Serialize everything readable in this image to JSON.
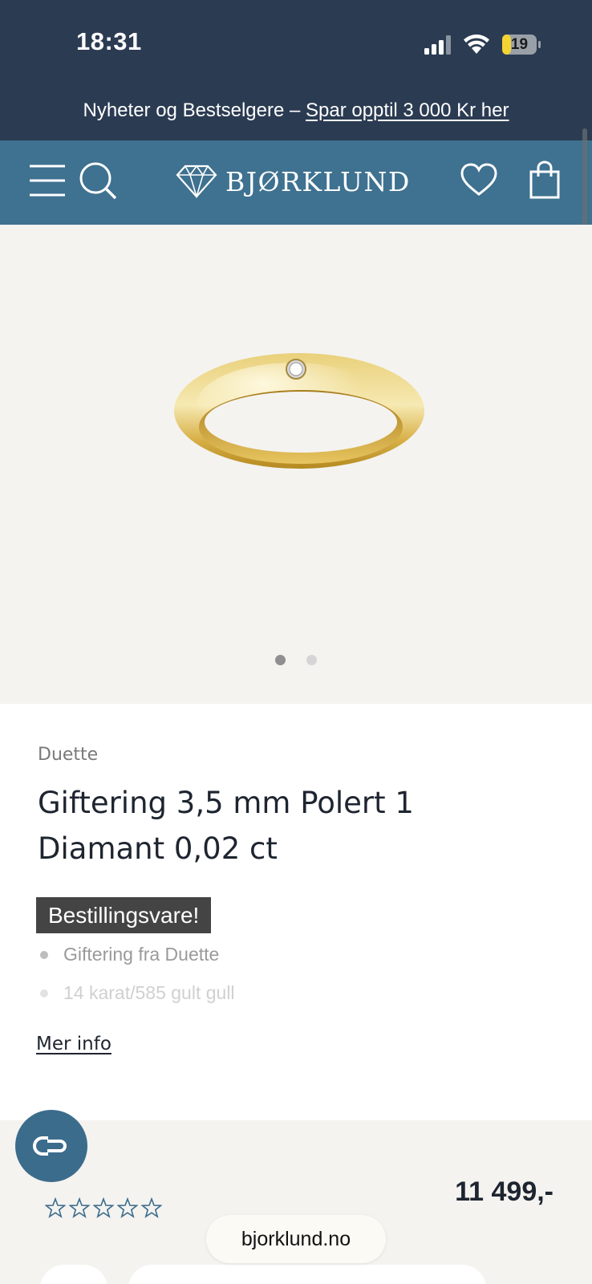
{
  "status_bar": {
    "time": "18:31",
    "battery": "19"
  },
  "promo": {
    "text": "Nyheter og Bestselgere  – ",
    "link": "Spar opptil 3 000 Kr her"
  },
  "nav": {
    "logo_text": "BJØRKLUND"
  },
  "gallery": {
    "slides": 2,
    "active_slide": 1
  },
  "product": {
    "brand": "Duette",
    "title": "Giftering 3,5 mm Polert 1 Diamant 0,02 ct",
    "badge": "Bestillingsvare!",
    "features": [
      "Giftering fra Duette",
      "14 karat/585 gult gull"
    ],
    "more_info": "Mer info",
    "rating": 0,
    "rating_max": 5,
    "price": "11 499,-"
  },
  "browser": {
    "url": "bjorklund.no"
  },
  "colors": {
    "header_dark": "#2b3b52",
    "nav_blue": "#3f7190",
    "chat_button": "#3c6c8c",
    "gallery_bg": "#f4f3f0"
  }
}
